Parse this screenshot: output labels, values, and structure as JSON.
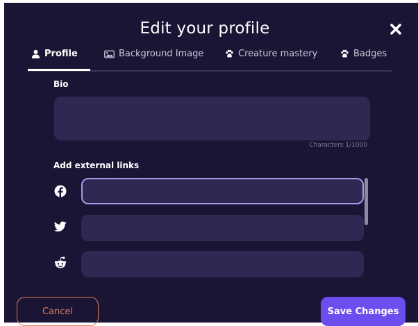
{
  "modal": {
    "title": "Edit your profile",
    "close_icon": "close-icon"
  },
  "tabs": [
    {
      "label": "Profile",
      "icon": "user-icon",
      "active": true
    },
    {
      "label": "Background Image",
      "icon": "image-icon",
      "active": false
    },
    {
      "label": "Creature mastery",
      "icon": "paw-icon",
      "active": false
    },
    {
      "label": "Badges",
      "icon": "paw-icon",
      "active": false
    }
  ],
  "bio": {
    "label": "Bio",
    "value": "",
    "char_count": "Characters 1/1000"
  },
  "links": {
    "label": "Add external links",
    "items": [
      {
        "icon": "facebook-icon",
        "value": ""
      },
      {
        "icon": "twitter-icon",
        "value": ""
      },
      {
        "icon": "reddit-icon",
        "value": ""
      }
    ]
  },
  "footer": {
    "cancel_label": "Cancel",
    "save_label": "Save Changes"
  },
  "colors": {
    "background": "#1b1535",
    "input": "#2f2852",
    "accent": "#6c4df0",
    "cancel": "#e07b5a",
    "focus_border": "#a89ae8"
  }
}
